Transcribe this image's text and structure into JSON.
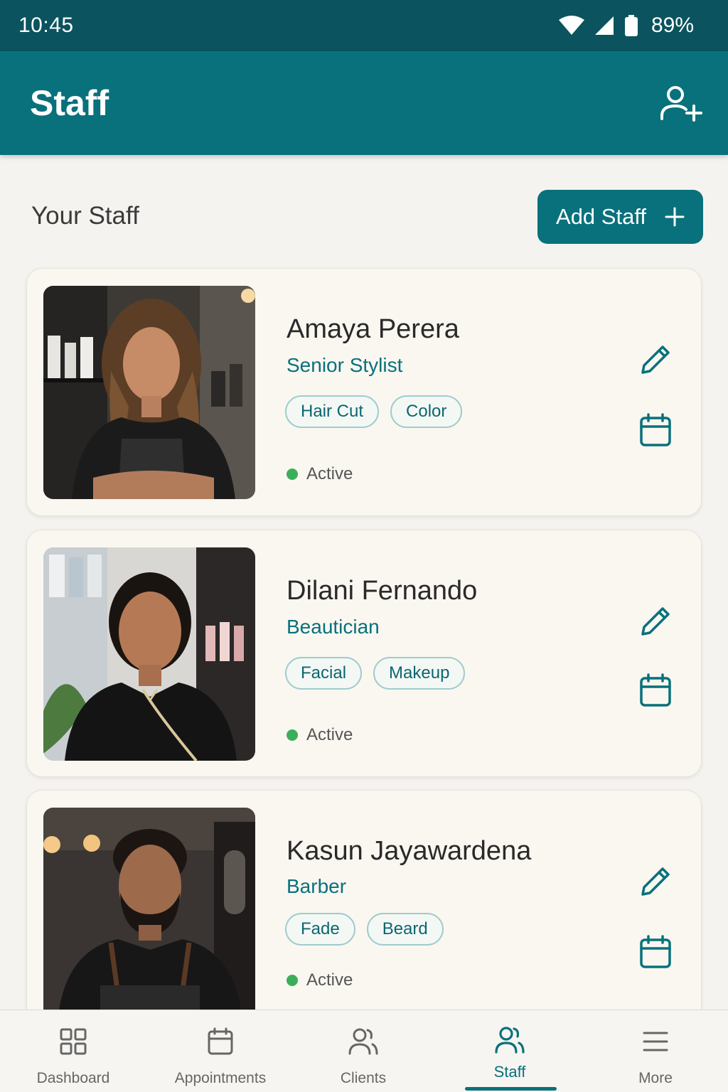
{
  "status_bar": {
    "time": "10:45",
    "battery": "89%"
  },
  "app_bar": {
    "title": "Staff",
    "add_user_icon": "person-add-icon"
  },
  "section": {
    "title": "Your Staff",
    "add_button_label": "Add Staff"
  },
  "staff": [
    {
      "name": "Amaya Perera",
      "role": "Senior Stylist",
      "tags": [
        "Hair Cut",
        "Color"
      ],
      "status": "Active"
    },
    {
      "name": "Dilani Fernando",
      "role": "Beautician",
      "tags": [
        "Facial",
        "Makeup"
      ],
      "status": "Active"
    },
    {
      "name": "Kasun Jayawardena",
      "role": "Barber",
      "tags": [
        "Fade",
        "Beard"
      ],
      "status": "Active"
    }
  ],
  "bottom_nav": [
    {
      "label": "Dashboard",
      "icon": "grid-icon"
    },
    {
      "label": "Appointments",
      "icon": "calendar-icon"
    },
    {
      "label": "Clients",
      "icon": "people-icon"
    },
    {
      "label": "Staff",
      "icon": "people-icon",
      "active": true
    },
    {
      "label": "More",
      "icon": "menu-icon"
    }
  ],
  "colors": {
    "primary": "#08717c",
    "status_bar": "#0b535e",
    "active_dot": "#3cae5b",
    "background": "#f5f3ef"
  }
}
